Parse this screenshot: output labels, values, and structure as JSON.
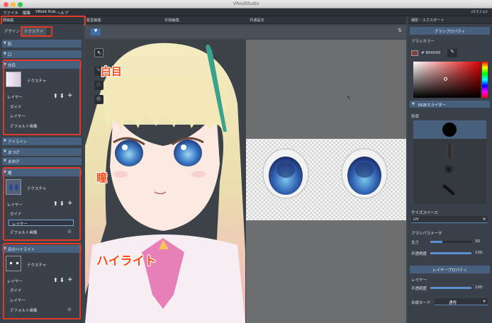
{
  "window": {
    "title": "VRoidStudio",
    "version": "v0.5.2-p1"
  },
  "menu": [
    "ファイル",
    "編集",
    "VRoid Hub",
    "ヘルプ"
  ],
  "sections": [
    "顔編集",
    "髪型編集",
    "衣装編集",
    "共通設定",
    "撮影・エクスポート"
  ],
  "left_tabs": {
    "design": "デザイン",
    "texture": "テクスチャ"
  },
  "parts": {
    "face": "肌",
    "mouth": "口",
    "white_eye": {
      "title": "白目",
      "texture_label": "テクスチャ",
      "layer_label": "レイヤー",
      "items": [
        "ガイド",
        "レイヤー",
        "デフォルト画像"
      ]
    },
    "eyeline": "アイライン",
    "eyelash": "まつげ",
    "eyebrow": "まゆげ",
    "pupil": {
      "title": "瞳",
      "texture_label": "テクスチャ",
      "layer_label": "レイヤー",
      "guide": "ガイド",
      "layer_field": "レイヤー",
      "default_image": "デフォルト画像"
    },
    "highlight": {
      "title": "目のハイライト",
      "texture_label": "テクスチャ",
      "layer_label": "レイヤー",
      "items": [
        "ガイド",
        "レイヤー",
        "デフォルト画像"
      ]
    }
  },
  "annotations": {
    "white_eye": "白目",
    "pupil": "瞳",
    "highlight": "ハイライト"
  },
  "brush": {
    "header": "ブラシプロパティ",
    "color_label": "ブラシカラー",
    "color_hex": "# 804040",
    "color_value": "#804040",
    "rgb_slider": "RGBスライダー",
    "shape_label": "形状",
    "size_space_label": "サイズスペース",
    "size_space_value": "UV",
    "params_label": "ブラシパラメータ",
    "thickness_label": "太さ",
    "thickness_value": "30",
    "thickness_level": 0.3,
    "opacity_label": "不透明度",
    "opacity_value": "100",
    "opacity_level": 1.0
  },
  "layer_props": {
    "header": "レイヤープロパティ",
    "layer_label": "レイヤー",
    "opacity_label": "不透明度",
    "opacity_value": "100",
    "opacity_level": 1.0,
    "blend_label": "合成モード",
    "blend_value": "通常"
  },
  "colors": {
    "accent": "#46607e",
    "annotation": "#ff4a14",
    "brush": "#804040"
  }
}
